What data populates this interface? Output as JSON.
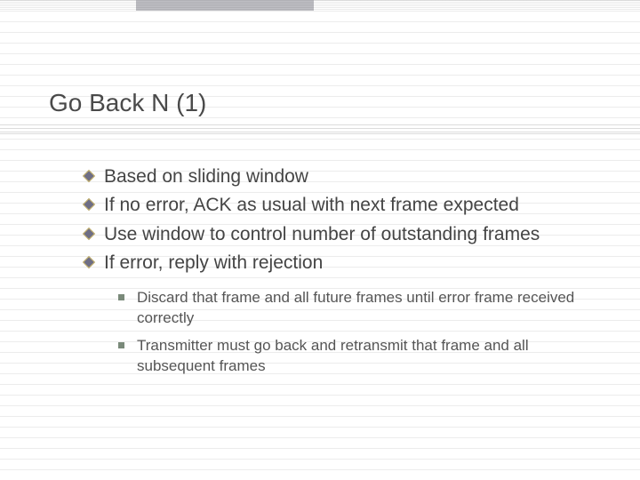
{
  "title": "Go Back N (1)",
  "bullets": [
    "Based on sliding window",
    "If no error, ACK as usual with next frame expected",
    "Use window to control number of outstanding frames",
    "If error, reply with rejection"
  ],
  "subbullets": [
    "Discard that frame and all future frames until error frame received correctly",
    "Transmitter must go back and retransmit that frame and all subsequent frames"
  ]
}
